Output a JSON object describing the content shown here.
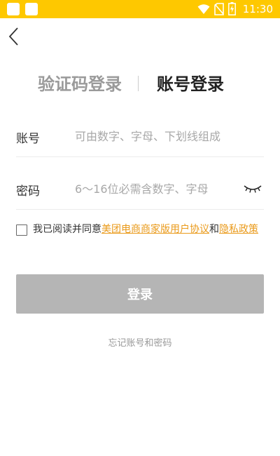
{
  "status_bar": {
    "time": "11:30",
    "color": "#fec800"
  },
  "header": {
    "back_icon": "chevron-left-icon"
  },
  "tabs": [
    {
      "label": "验证码登录",
      "active": false
    },
    {
      "label": "账号登录",
      "active": true
    }
  ],
  "form": {
    "account": {
      "label": "账号",
      "placeholder": "可由数字、字母、下划线组成"
    },
    "password": {
      "label": "密码",
      "placeholder": "6～16位必需含数字、字母",
      "toggle_icon": "eye-closed-icon"
    }
  },
  "agreement": {
    "prefix": "我已阅读并同意",
    "link1": "美团电商商家版用户协议",
    "joiner": "和",
    "link2": "隐私政策",
    "checked": false,
    "link_color": "#ea9a1a"
  },
  "login_button": {
    "label": "登录",
    "color": "#b5b5b5"
  },
  "forgot": {
    "label": "忘记账号和密码"
  }
}
